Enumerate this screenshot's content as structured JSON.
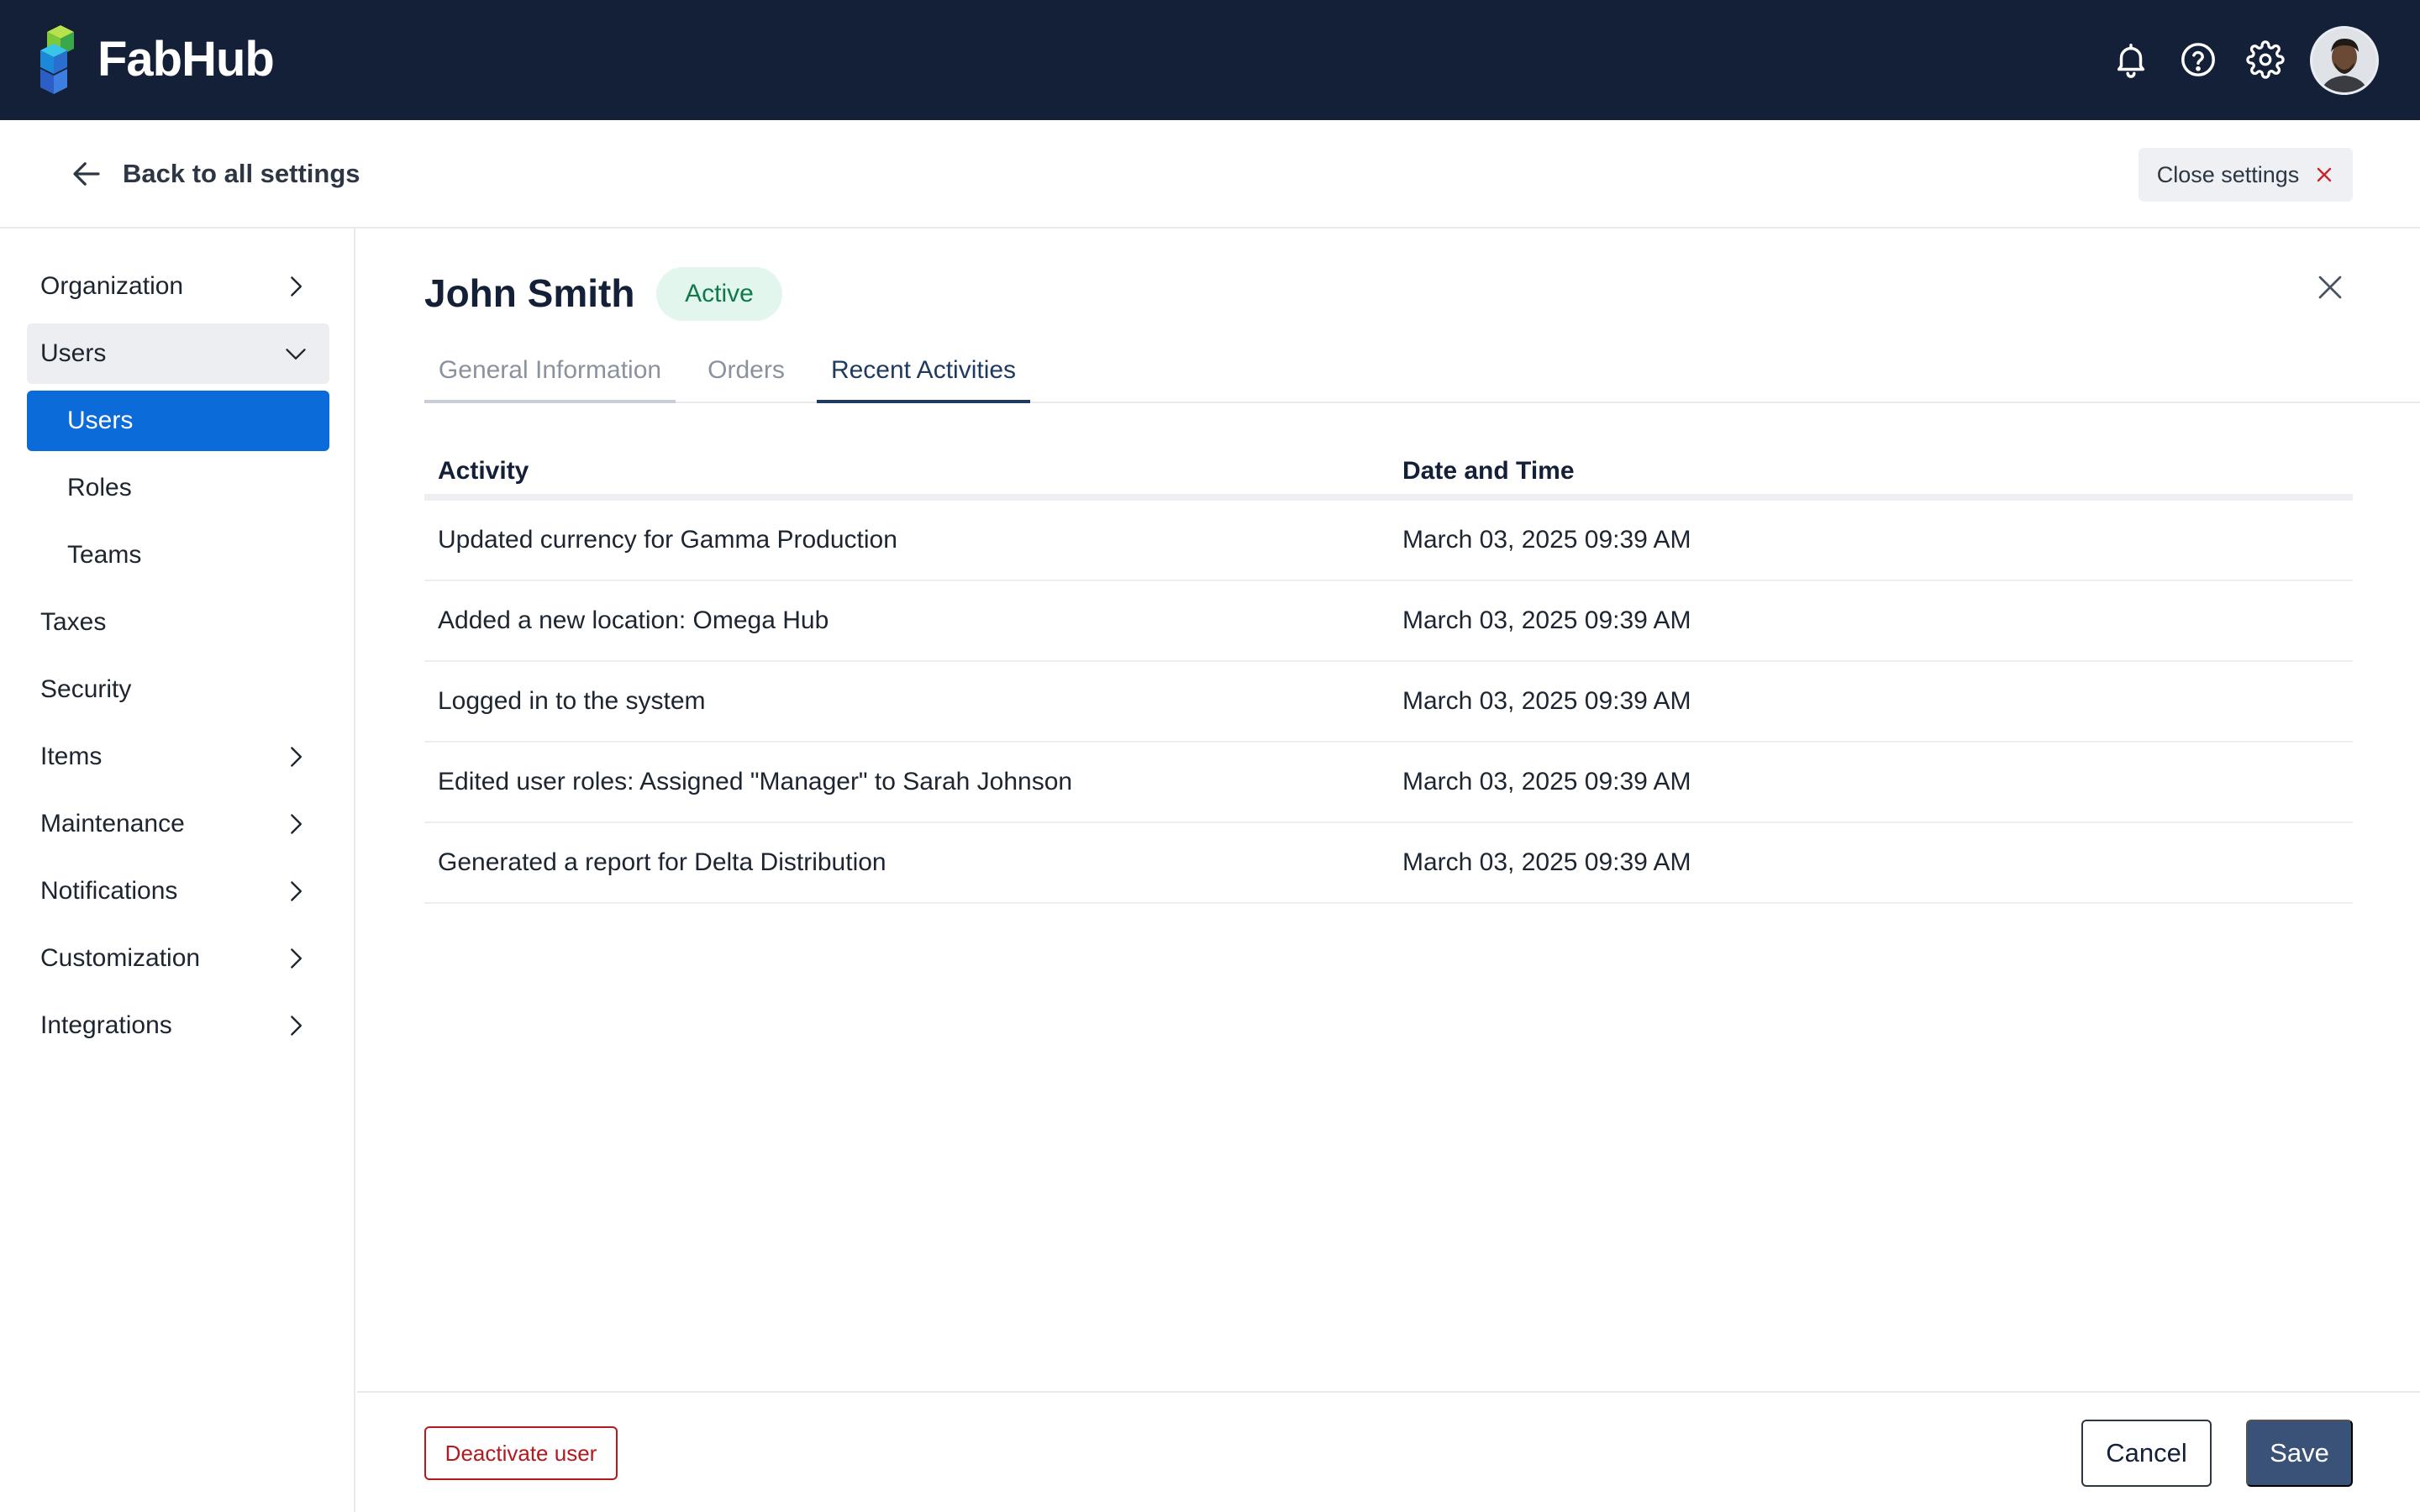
{
  "app": {
    "name": "FabHub"
  },
  "topbar": {
    "icons": [
      "bell-icon",
      "help-icon",
      "gear-icon"
    ],
    "colors": {
      "background": "#141f38"
    }
  },
  "subheader": {
    "back_label": "Back to all settings",
    "close_label": "Close settings"
  },
  "sidebar": {
    "items": [
      {
        "label": "Organization",
        "chevron": "right"
      },
      {
        "label": "Users",
        "chevron": "down",
        "expanded": true
      },
      {
        "label": "Users",
        "sub": true,
        "active": true
      },
      {
        "label": "Roles",
        "sub": true
      },
      {
        "label": "Teams",
        "sub": true
      },
      {
        "label": "Taxes"
      },
      {
        "label": "Security"
      },
      {
        "label": "Items",
        "chevron": "right"
      },
      {
        "label": "Maintenance",
        "chevron": "right"
      },
      {
        "label": "Notifications",
        "chevron": "right"
      },
      {
        "label": "Customization",
        "chevron": "right"
      },
      {
        "label": "Integrations",
        "chevron": "right"
      }
    ],
    "active_color": "#0b6bd9"
  },
  "user": {
    "name": "John Smith",
    "status": "Active",
    "status_color": "#0e7a4c"
  },
  "tabs": [
    {
      "label": "General Information"
    },
    {
      "label": "Orders"
    },
    {
      "label": "Recent Activities",
      "selected": true
    }
  ],
  "activities": {
    "headers": {
      "activity": "Activity",
      "datetime": "Date and Time"
    },
    "rows": [
      {
        "activity": "Updated currency for Gamma Production",
        "datetime": "March 03, 2025 09:39 AM"
      },
      {
        "activity": "Added a new location: Omega Hub",
        "datetime": "March 03, 2025 09:39 AM"
      },
      {
        "activity": "Logged in to the system",
        "datetime": "March 03, 2025 09:39 AM"
      },
      {
        "activity": "Edited user roles: Assigned \"Manager\" to Sarah Johnson",
        "datetime": "March 03, 2025 09:39 AM"
      },
      {
        "activity": "Generated a report for Delta Distribution",
        "datetime": "March 03, 2025 09:39 AM"
      }
    ]
  },
  "footer": {
    "deactivate_label": "Deactivate user",
    "cancel_label": "Cancel",
    "save_label": "Save",
    "danger_color": "#b3191e",
    "primary_color": "#3a5277"
  }
}
